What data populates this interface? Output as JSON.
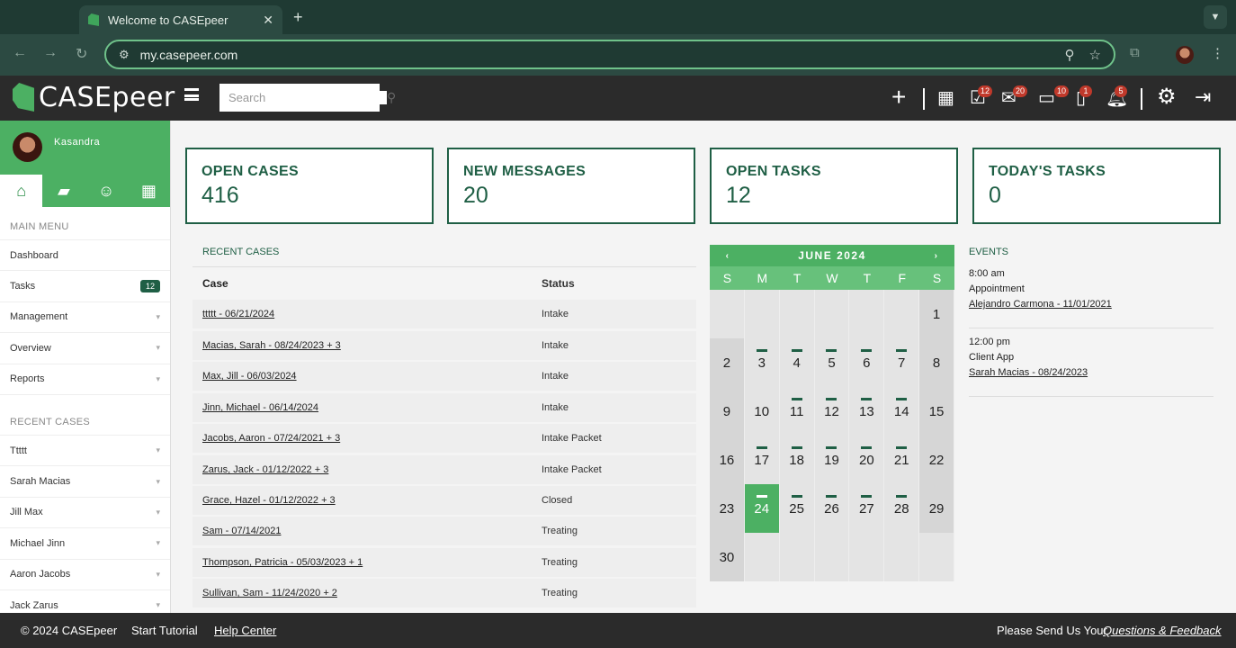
{
  "browser": {
    "tab_title": "Welcome to CASEpeer",
    "tab_close": "✕",
    "new_tab": "+",
    "url": "my.casepeer.com"
  },
  "header": {
    "logo": "CASEpeer",
    "search_placeholder": "Search",
    "badges": {
      "tasks": "12",
      "messages": "20",
      "inbox": "10",
      "phone": "1",
      "notifications": "5"
    }
  },
  "sidebar": {
    "user_name": "Kasandra",
    "main_menu_title": "MAIN MENU",
    "main_menu": [
      {
        "label": "Dashboard"
      },
      {
        "label": "Tasks",
        "count": "12"
      },
      {
        "label": "Management"
      },
      {
        "label": "Overview"
      },
      {
        "label": "Reports"
      }
    ],
    "recent_title": "RECENT CASES",
    "recent": [
      {
        "label": "Ttttt"
      },
      {
        "label": "Sarah Macias"
      },
      {
        "label": "Jill Max"
      },
      {
        "label": "Michael Jinn"
      },
      {
        "label": "Aaron Jacobs"
      },
      {
        "label": "Jack Zarus"
      }
    ]
  },
  "stats": [
    {
      "title": "OPEN CASES",
      "value": "416"
    },
    {
      "title": "NEW MESSAGES",
      "value": "20"
    },
    {
      "title": "OPEN TASKS",
      "value": "12"
    },
    {
      "title": "TODAY'S TASKS",
      "value": "0"
    }
  ],
  "recent_cases": {
    "title": "RECENT CASES",
    "col_case": "Case",
    "col_status": "Status",
    "rows": [
      {
        "case": "ttttt - 06/21/2024",
        "status": "Intake"
      },
      {
        "case": "Macias, Sarah - 08/24/2023 + 3",
        "status": "Intake"
      },
      {
        "case": "Max, Jill - 06/03/2024",
        "status": "Intake"
      },
      {
        "case": "Jinn, Michael - 06/14/2024",
        "status": "Intake"
      },
      {
        "case": "Jacobs, Aaron - 07/24/2021 + 3",
        "status": "Intake Packet"
      },
      {
        "case": "Zarus, Jack - 01/12/2022 + 3",
        "status": "Intake Packet"
      },
      {
        "case": "Grace, Hazel - 01/12/2022 + 3",
        "status": "Closed"
      },
      {
        "case": "Sam - 07/14/2021",
        "status": "Treating"
      },
      {
        "case": "Thompson, Patricia - 05/03/2023 + 1",
        "status": "Treating"
      },
      {
        "case": "Sullivan, Sam - 11/24/2020 + 2",
        "status": "Treating"
      }
    ]
  },
  "calendar": {
    "month": "JUNE 2024",
    "prev": "‹",
    "next": "›",
    "dow": [
      "S",
      "M",
      "T",
      "W",
      "T",
      "F",
      "S"
    ],
    "leading_blanks": 6,
    "days_in_month": 30,
    "today": 24,
    "marked_days": [
      3,
      4,
      5,
      6,
      7,
      11,
      12,
      13,
      14,
      17,
      18,
      19,
      20,
      21,
      24,
      25,
      26,
      27,
      28
    ]
  },
  "events": {
    "title": "EVENTS",
    "items": [
      {
        "time": "8:00 am",
        "name": "Appointment",
        "case": "Alejandro Carmona - 11/01/2021"
      },
      {
        "time": "12:00 pm",
        "name": "Client App",
        "case": "Sarah Macias - 08/24/2023"
      }
    ]
  },
  "footer": {
    "copyright": "© 2024 CASEpeer",
    "tutorial": "Start Tutorial",
    "help": "Help Center",
    "feedback_prefix": "Please Send Us Your",
    "feedback_link": "Questions & Feedback"
  }
}
